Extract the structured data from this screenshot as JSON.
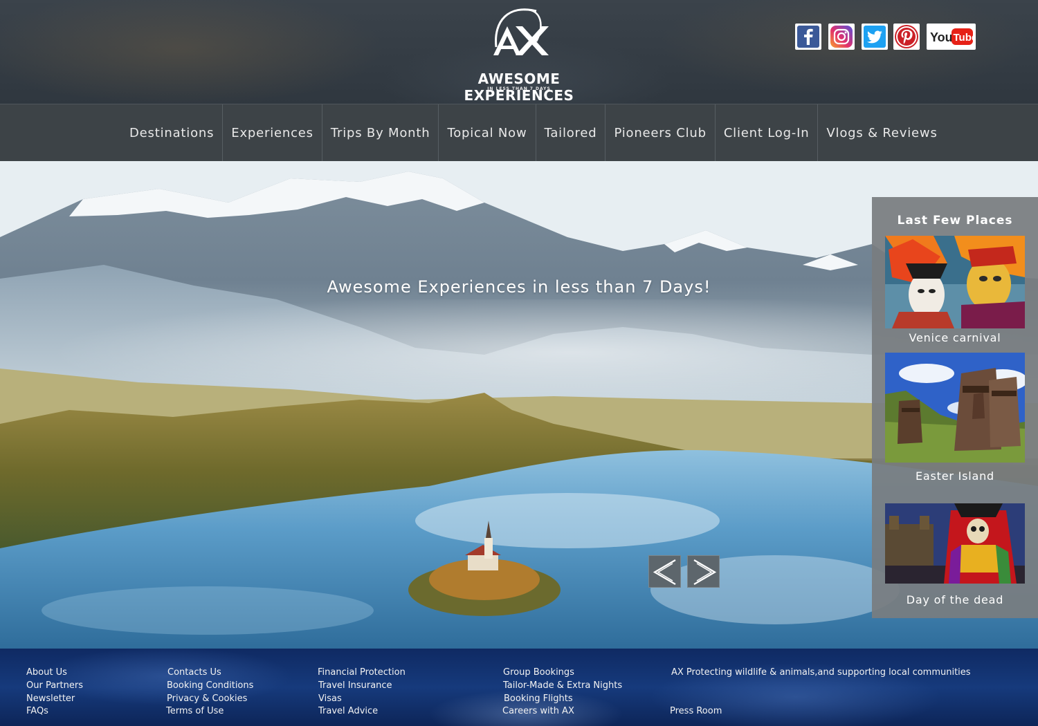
{
  "header": {
    "logo_monogram": "AX",
    "logo_title": "AWESOME EXPERIENCES",
    "logo_tagline": "IN LESS THAN 7 DAYS",
    "social": [
      {
        "name": "facebook-icon",
        "color": "#3b5998"
      },
      {
        "name": "instagram-icon",
        "color": "#c13584"
      },
      {
        "name": "twitter-icon",
        "color": "#1da1f2"
      },
      {
        "name": "pinterest-icon",
        "color": "#cb2027"
      },
      {
        "name": "youtube-icon",
        "label": "YouTube",
        "color": "#e62117"
      }
    ]
  },
  "nav": {
    "items": [
      {
        "label": "Destinations"
      },
      {
        "label": "Experiences"
      },
      {
        "label": "Trips By Month"
      },
      {
        "label": "Topical Now"
      },
      {
        "label": "Tailored"
      },
      {
        "label": "Pioneers Club"
      },
      {
        "label": "Client Log-In"
      },
      {
        "label": "Vlogs & Reviews"
      }
    ]
  },
  "hero": {
    "title": "Awesome Experiences in less than 7 Days!",
    "prev_icon": "chevron-left-icon",
    "next_icon": "chevron-right-icon"
  },
  "sidebar": {
    "title": "Last Few Places",
    "places": [
      {
        "caption": "Venice carnival"
      },
      {
        "caption": "Easter Island"
      },
      {
        "caption": "Day of the dead"
      }
    ]
  },
  "footer": {
    "col1": [
      "About Us",
      "Our Partners",
      "Newsletter",
      "FAQs"
    ],
    "col2": [
      "Contacts Us",
      "Booking Conditions",
      "Privacy & Cookies",
      "Terms of Use"
    ],
    "col3": [
      "Financial Protection",
      "Travel Insurance",
      "Visas",
      "Travel Advice"
    ],
    "col4": [
      "Group Bookings",
      "Tailor-Made & Extra Nights",
      "Booking Flights",
      "Careers with AX"
    ],
    "col5": [
      "AX Protecting wildlife & animals,and supporting local communities",
      "Press Room"
    ]
  },
  "colors": {
    "nav_bg": "#3d4347",
    "sidebar_bg": "#787d80",
    "footer_bg": "#163a7c"
  }
}
